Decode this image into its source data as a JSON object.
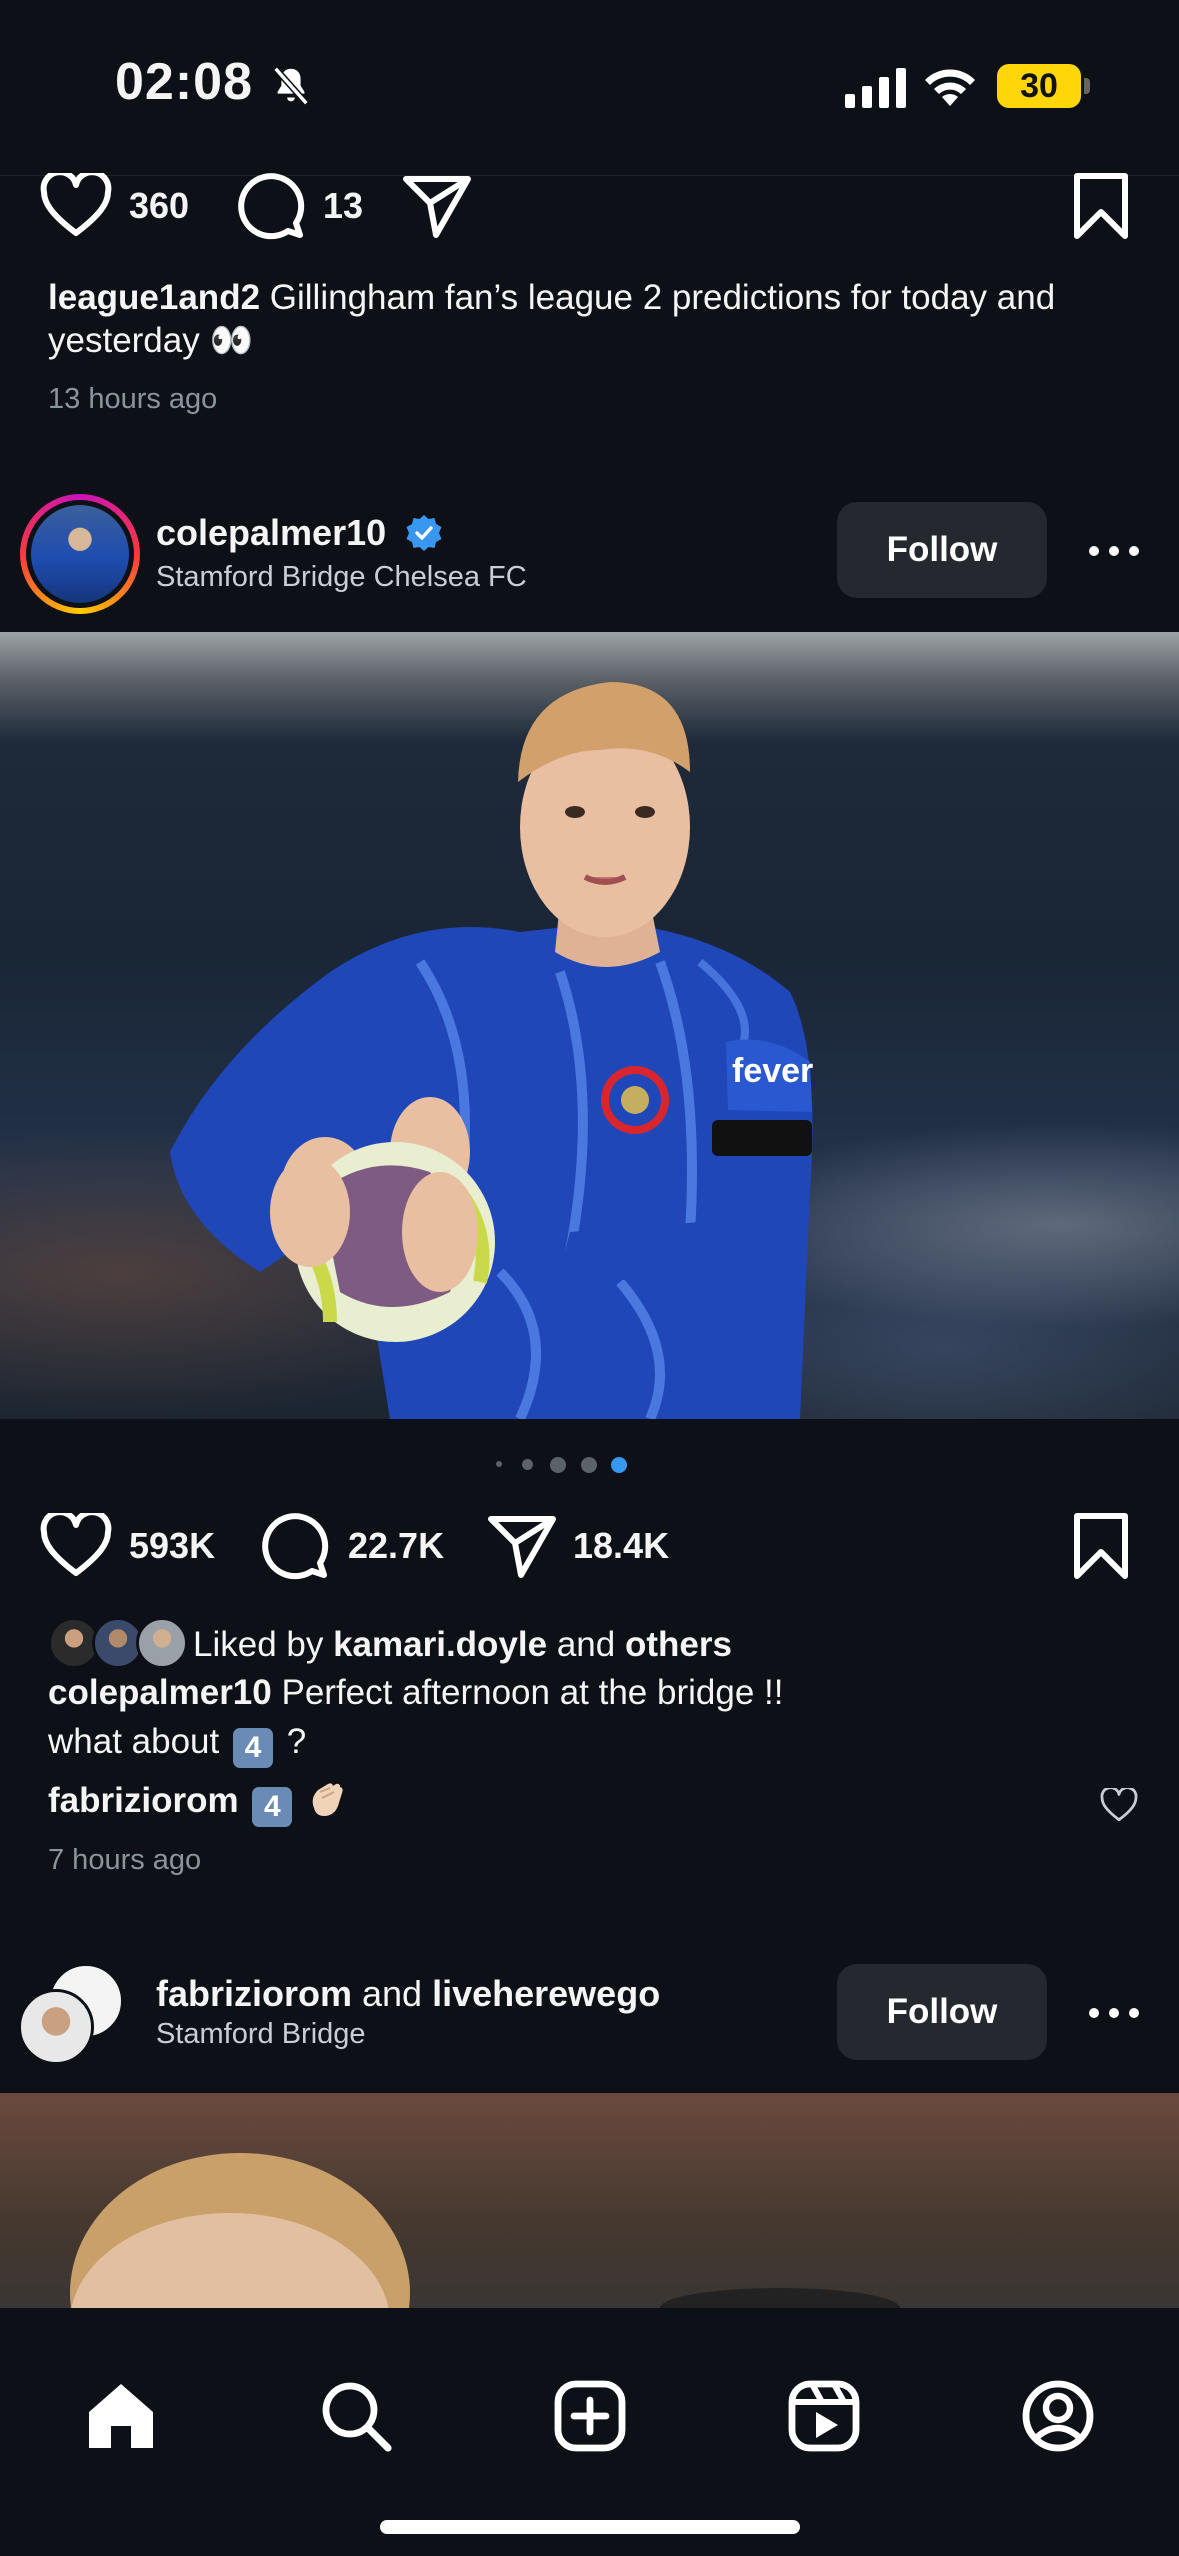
{
  "status_bar": {
    "time": "02:08",
    "battery": "30"
  },
  "post_prev": {
    "likes": "360",
    "comments": "13",
    "caption_user": "league1and2",
    "caption_text": " Gillingham fan’s league 2 predictions for today and yesterday 👀",
    "time_ago": "13 hours ago"
  },
  "post_main": {
    "username": "colepalmer10",
    "location": "Stamford Bridge Chelsea FC",
    "follow_label": "Follow",
    "likes": "593K",
    "comments": "22.7K",
    "shares": "18.4K",
    "liked_prefix": "Liked by ",
    "liked_user": "kamari.doyle",
    "liked_mid": " and ",
    "liked_others": "others",
    "caption_user": "colepalmer10",
    "caption_text": " Perfect afternoon at the bridge !!",
    "caption_line2": "what about",
    "caption_keycap": "4",
    "caption_end": " ?",
    "comment_user": "fabriziorom",
    "comment_keycap": "4",
    "time_ago": "7 hours ago",
    "carousel_count": 5,
    "carousel_active": 5
  },
  "post_next": {
    "user1": "fabriziorom",
    "and": " and ",
    "user2": "liveherewego",
    "location": "Stamford Bridge",
    "follow_label": "Follow"
  },
  "colors": {
    "background": "#0d1117",
    "accent_blue": "#3897f0",
    "battery": "#ffd60a"
  },
  "tab_bar": [
    "home-icon",
    "search-icon",
    "create-icon",
    "reels-icon",
    "profile-icon"
  ]
}
